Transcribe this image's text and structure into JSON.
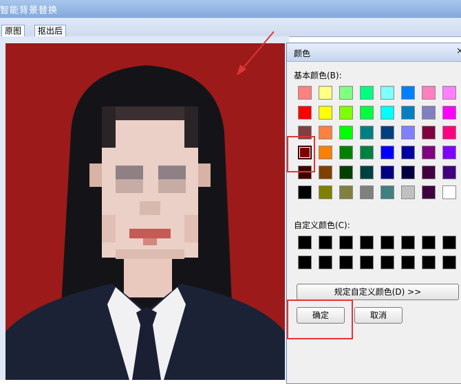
{
  "window": {
    "title": "智能背景替换"
  },
  "tabs": [
    {
      "label": "原图",
      "active": true
    },
    {
      "label": "抠出后",
      "active": false
    }
  ],
  "photo": {
    "background_color": "#9c1a1a",
    "faces_pixelated": true
  },
  "dialog": {
    "title": "颜色",
    "close_glyph": "×",
    "basic_colors_label": "基本颜色(B):",
    "custom_colors_label": "自定义颜色(C):",
    "define_custom_button": "规定自定义颜色(D) >>",
    "ok_button": "确定",
    "cancel_button": "取消",
    "selected_color": "#800000",
    "basic_colors": [
      [
        "#ff8080",
        "#ffff80",
        "#80ff80",
        "#00ff80",
        "#80ffff",
        "#0080ff",
        "#ff80c0",
        "#ff80ff"
      ],
      [
        "#ff0000",
        "#ffff00",
        "#80ff00",
        "#00ff40",
        "#00ffff",
        "#0080c0",
        "#8080c0",
        "#ff00ff"
      ],
      [
        "#804040",
        "#ff8040",
        "#00ff00",
        "#008080",
        "#004080",
        "#8080ff",
        "#800040",
        "#ff0080"
      ],
      [
        "#800000",
        "#ff8000",
        "#008000",
        "#008040",
        "#0000ff",
        "#0000a0",
        "#800080",
        "#8000ff"
      ],
      [
        "#400000",
        "#804000",
        "#004000",
        "#004040",
        "#000080",
        "#000040",
        "#400040",
        "#400080"
      ],
      [
        "#000000",
        "#808000",
        "#808040",
        "#808080",
        "#408080",
        "#c0c0c0",
        "#400040",
        "#ffffff"
      ]
    ],
    "custom_colors": [
      [
        "#000000",
        "#000000",
        "#000000",
        "#000000",
        "#000000",
        "#000000",
        "#000000",
        "#000000"
      ],
      [
        "#000000",
        "#000000",
        "#000000",
        "#000000",
        "#000000",
        "#000000",
        "#000000",
        "#000000"
      ]
    ]
  },
  "annotations": {
    "highlight_color": "#e03535"
  }
}
